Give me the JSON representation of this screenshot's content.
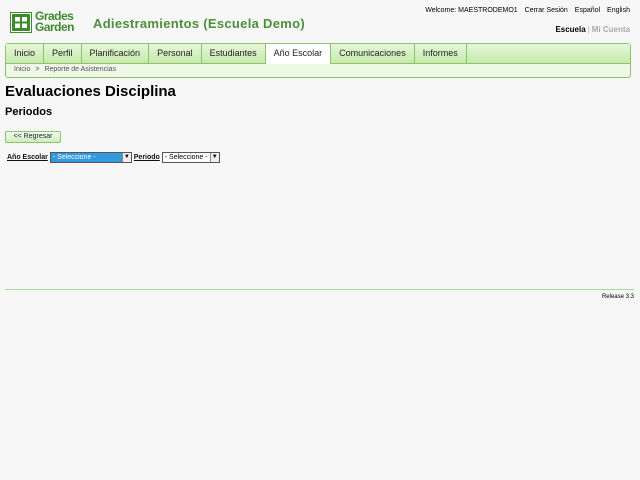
{
  "header": {
    "logo_line1": "Grades",
    "logo_line2": "Garden",
    "app_title": "Adiestramientos (Escuela Demo)",
    "welcome": "Welcome: MAESTRODEMO1",
    "logout": "Cerrar Sesión",
    "lang_es": "Español",
    "lang_en": "English",
    "switch_active": "Escuela",
    "switch_separator": "|",
    "switch_inactive": "Mi Cuenta"
  },
  "nav": {
    "tabs": [
      "Inicio",
      "Perfil",
      "Planificación",
      "Personal",
      "Estudiantes",
      "Año Escolar",
      "Comunicaciones",
      "Informes"
    ],
    "active_tab": "Año Escolar"
  },
  "breadcrumb": {
    "home": "Inicio",
    "separator": ">",
    "current": "Reporte de Asistencias"
  },
  "page": {
    "title": "Evaluaciones Disciplina",
    "subtitle": "Periodos",
    "back_label": "<< Regresar"
  },
  "filters": {
    "year_label": "Año Escolar",
    "year_value": "- Seleccione -",
    "period_label": "Periodo",
    "period_value": "- Seleccione -"
  },
  "footer": {
    "release": "Release 3.3"
  },
  "colors": {
    "brand_green": "#4a8f3a",
    "nav_border": "#8cc46e",
    "select_highlight": "#3399dd"
  }
}
